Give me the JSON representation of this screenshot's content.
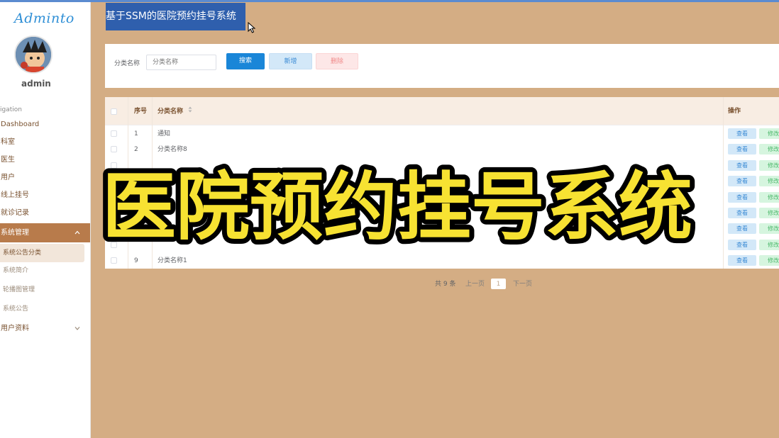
{
  "window": {
    "title": "基于SSM的医院预约挂号系统"
  },
  "sidebar": {
    "logo": "Adminto",
    "user": "admin",
    "nav_heading": "igation",
    "items": [
      {
        "label": "Dashboard"
      },
      {
        "label": "科室"
      },
      {
        "label": "医生"
      },
      {
        "label": "用户"
      },
      {
        "label": "线上挂号"
      },
      {
        "label": "就诊记录"
      }
    ],
    "group": {
      "label": "系统管理",
      "sub_items": [
        {
          "label": "系统公告分类",
          "active": true
        },
        {
          "label": "系统简介"
        },
        {
          "label": "轮播图管理"
        },
        {
          "label": "系统公告"
        }
      ]
    },
    "user_profile": {
      "label": "用户资料"
    }
  },
  "search": {
    "label": "分类名称",
    "placeholder": "分类名称",
    "search_label": "搜索",
    "add_label": "新增",
    "delete_label": "删除"
  },
  "table": {
    "columns": {
      "index": "序号",
      "name": "分类名称",
      "actions": "操作"
    },
    "action_labels": {
      "view": "查看",
      "edit": "修改"
    },
    "rows": [
      {
        "index": "1",
        "name": "通知"
      },
      {
        "index": "2",
        "name": "分类名称8"
      },
      {
        "index": "",
        "name": ""
      },
      {
        "index": "",
        "name": ""
      },
      {
        "index": "",
        "name": ""
      },
      {
        "index": "",
        "name": ""
      },
      {
        "index": "",
        "name": ""
      },
      {
        "index": "",
        "name": ""
      },
      {
        "index": "9",
        "name": "分类名称1"
      }
    ]
  },
  "pagination": {
    "total": "共 9 条",
    "prev": "上一页",
    "current": "1",
    "next": "下一页"
  },
  "overlay": {
    "caption": "医院预约挂号系统"
  },
  "colors": {
    "background": "#d4ad84",
    "accent": "#b87b4b",
    "primary": "#1a86d8",
    "caption_fill": "#f7e232"
  },
  "icons": {
    "sort": "sort-icon",
    "chevron_up": "chevron-up-icon",
    "chevron_down": "chevron-down-icon",
    "cursor": "mouse-cursor-icon"
  }
}
